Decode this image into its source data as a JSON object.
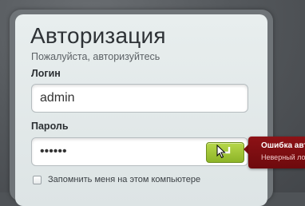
{
  "form": {
    "title": "Авторизация",
    "subtitle": "Пожалуйста, авторизуйтесь",
    "login_label": "Логин",
    "login_value": "admin",
    "password_label": "Пароль",
    "password_value": "••••••",
    "submit_icon": "enter-arrow-icon",
    "remember_label": "Запомнить меня на этом компьютере",
    "remember_checked": false
  },
  "error": {
    "title": "Ошибка авто",
    "text": "Неверный логи"
  },
  "colors": {
    "background": "#4f5357",
    "panel": "#e3e9ea",
    "submit": "#9ec232",
    "error": "#7e0e12"
  }
}
